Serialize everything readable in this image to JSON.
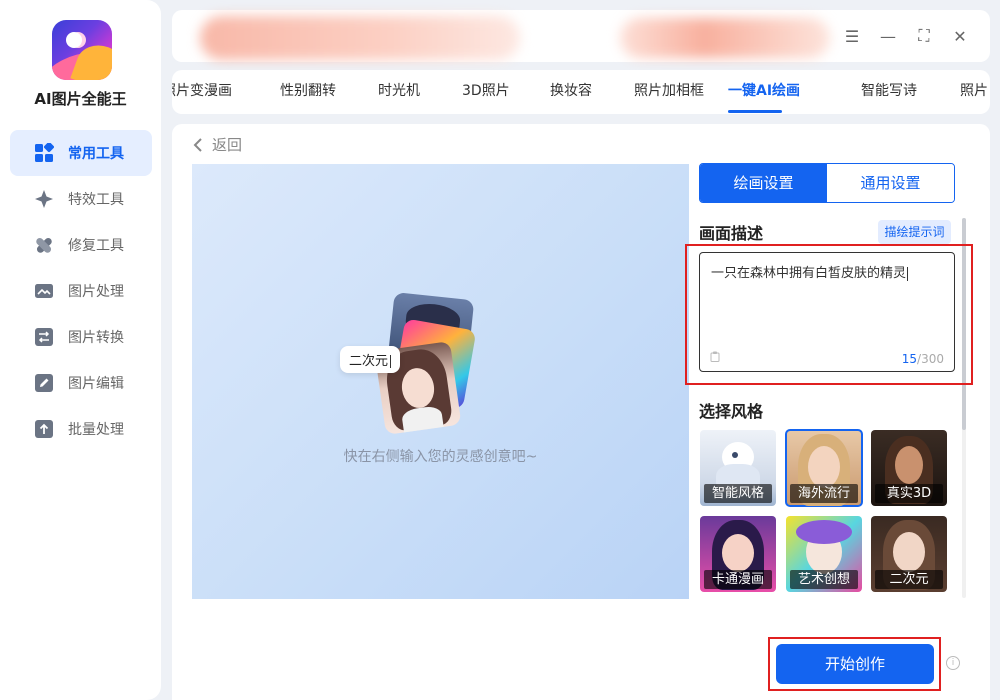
{
  "app": {
    "title": "AI图片全能王",
    "accent_color": "#1464f0"
  },
  "sidebar": {
    "items": [
      {
        "label": "常用工具",
        "icon": "grid-icon",
        "active": true
      },
      {
        "label": "特效工具",
        "icon": "sparkle-icon",
        "active": false
      },
      {
        "label": "修复工具",
        "icon": "bandage-icon",
        "active": false
      },
      {
        "label": "图片处理",
        "icon": "image-icon",
        "active": false
      },
      {
        "label": "图片转换",
        "icon": "convert-icon",
        "active": false
      },
      {
        "label": "图片编辑",
        "icon": "edit-icon",
        "active": false
      },
      {
        "label": "批量处理",
        "icon": "upload-icon",
        "active": false
      }
    ]
  },
  "window_controls": {
    "menu": "☰",
    "minimize": "—",
    "maximize": "⛶",
    "close": "✕"
  },
  "tabs": [
    {
      "label": "照片变漫画",
      "active": false
    },
    {
      "label": "性别翻转",
      "active": false
    },
    {
      "label": "时光机",
      "active": false
    },
    {
      "label": "3D照片",
      "active": false
    },
    {
      "label": "换妆容",
      "active": false
    },
    {
      "label": "照片加相框",
      "active": false
    },
    {
      "label": "一键AI绘画",
      "active": true
    },
    {
      "label": "智能写诗",
      "active": false
    },
    {
      "label": "照片",
      "active": false
    }
  ],
  "main": {
    "back_label": "返回",
    "preview": {
      "bubble_text": "二次元",
      "hint": "快在右侧输入您的灵感创意吧~"
    },
    "settings": {
      "tab_paint": "绘画设置",
      "tab_general": "通用设置",
      "desc_title": "画面描述",
      "tip_button": "描绘提示词",
      "prompt_text": "一只在森林中拥有白皙皮肤的精灵",
      "counter_current": "15",
      "counter_max": "/300",
      "style_title": "选择风格",
      "styles": [
        {
          "label": "智能风格",
          "selected": false
        },
        {
          "label": "海外流行",
          "selected": true
        },
        {
          "label": "真实3D",
          "selected": false
        },
        {
          "label": "卡通漫画",
          "selected": false
        },
        {
          "label": "艺术创想",
          "selected": false
        },
        {
          "label": "二次元",
          "selected": false
        }
      ]
    },
    "start_button": "开始创作"
  }
}
